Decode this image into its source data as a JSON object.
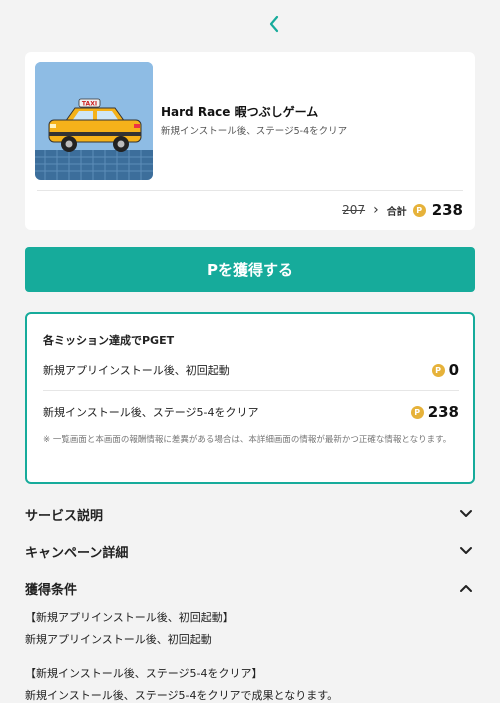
{
  "nav": {
    "back_icon": "chevron-left-icon"
  },
  "app": {
    "thumbnail_icon": "taxi-icon",
    "thumbnail_badge": "TAXI",
    "title": "Hard Race 暇つぶしゲーム",
    "subtitle": "新規インストール後、ステージ5-4をクリア",
    "old_points": "207",
    "total_label": "合計",
    "total_points": "238"
  },
  "coin_symbol": "P",
  "cta": {
    "label": "Pを獲得する"
  },
  "missions": {
    "heading": "各ミッション達成でPGET",
    "items": [
      {
        "label": "新規アプリインストール後、初回起動",
        "points": "0"
      },
      {
        "label": "新規インストール後、ステージ5-4をクリア",
        "points": "238"
      }
    ],
    "note": "※ 一覧画面と本画面の報酬情報に差異がある場合は、本詳細画面の情報が最新かつ正確な情報となります。"
  },
  "sections": {
    "service": "サービス説明",
    "campaign": "キャンペーン詳細",
    "conditions": "獲得条件"
  },
  "conditions": {
    "item1_title": "【新規アプリインストール後、初回起動】",
    "item1_body": "新規アプリインストール後、初回起動",
    "item2_title": "【新規インストール後、ステージ5-4をクリア】",
    "item2_body": "新規インストール後、ステージ5-4をクリアで成果となります。"
  },
  "colors": {
    "accent": "#16ab9b",
    "coin": "#e6b23a",
    "background": "#f3f3f3"
  }
}
